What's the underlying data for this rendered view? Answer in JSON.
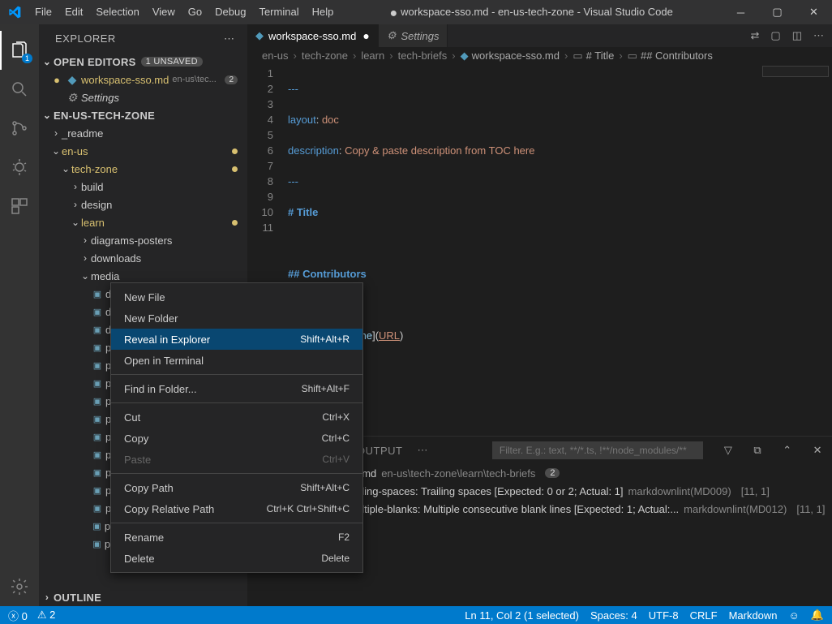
{
  "title": {
    "dot": "●",
    "text": "workspace-sso.md - en-us-tech-zone - Visual Studio Code"
  },
  "menu": {
    "file": "File",
    "edit": "Edit",
    "selection": "Selection",
    "view": "View",
    "go": "Go",
    "debug": "Debug",
    "terminal": "Terminal",
    "help": "Help"
  },
  "explorer": {
    "label": "EXPLORER"
  },
  "openEditors": {
    "label": "OPEN EDITORS",
    "unsaved": "1 UNSAVED"
  },
  "openFiles": {
    "f1": {
      "name": "workspace-sso.md",
      "path": "en-us\\tec...",
      "badge": "2"
    },
    "f2": {
      "name": "Settings"
    }
  },
  "workspace": {
    "label": "EN-US-TECH-ZONE"
  },
  "tree": {
    "readme": "_readme",
    "enus": "en-us",
    "techzone": "tech-zone",
    "build": "build",
    "design": "design",
    "learn": "learn",
    "diagrams": "diagrams-posters",
    "downloads": "downloads",
    "media": "media",
    "truncated": [
      "di",
      "di",
      "di",
      "po",
      "po",
      "po",
      "po",
      "po",
      "po",
      "po",
      "po",
      "po",
      "po"
    ],
    "poc1": "poc-guides_cvads-windows-vir...",
    "poc2": "poc-guides_cvads-windows-vir..."
  },
  "outline": {
    "label": "OUTLINE"
  },
  "tabs": {
    "t1": "workspace-sso.md",
    "t2": "Settings"
  },
  "breadcrumbs": {
    "p1": "en-us",
    "p2": "tech-zone",
    "p3": "learn",
    "p4": "tech-briefs",
    "p5": "workspace-sso.md",
    "p6": "# Title",
    "p7": "## Contributors"
  },
  "code": {
    "lines": [
      "1",
      "2",
      "3",
      "4",
      "5",
      "6",
      "7",
      "8",
      "9",
      "10",
      "11"
    ],
    "l1": "---",
    "l2a": "layout",
    "l2b": ": ",
    "l2c": "doc",
    "l3a": "description",
    "l3b": ": ",
    "l3c": "Copy & paste description from TOC here",
    "l4": "---",
    "l5": "# Title",
    "l7": "## Contributors",
    "l9a": "**Author:**",
    "l9b": " [",
    "l9c": "Name",
    "l9d": "](",
    "l9e": "URL",
    "l9f": ")"
  },
  "panel": {
    "tabs": {
      "problems": "PROBLEMS",
      "pcount": "2",
      "output": "OUTPUT"
    },
    "filter_placeholder": "Filter. E.g.: text, **/*.ts, !**/node_modules/**",
    "file": {
      "name": "workspace-sso.md",
      "path": "en-us\\tech-zone\\learn\\tech-briefs",
      "count": "2"
    },
    "p1": {
      "code": "MD009/no-trailing-spaces: Trailing spaces [Expected: 0 or 2; Actual: 1]",
      "src": "markdownlint(MD009)",
      "loc": "[11, 1]"
    },
    "p2": {
      "code": "MD012/no-multiple-blanks: Multiple consecutive blank lines [Expected: 1; Actual:...",
      "src": "markdownlint(MD012)",
      "loc": "[11, 1]"
    }
  },
  "status": {
    "errors": "0",
    "warnings": "2",
    "lncol": "Ln 11, Col 2 (1 selected)",
    "spaces": "Spaces: 4",
    "enc": "UTF-8",
    "eol": "CRLF",
    "lang": "Markdown"
  },
  "ctx": {
    "newfile": "New File",
    "newfolder": "New Folder",
    "reveal": "Reveal in Explorer",
    "reveal_kb": "Shift+Alt+R",
    "openterm": "Open in Terminal",
    "find": "Find in Folder...",
    "find_kb": "Shift+Alt+F",
    "cut": "Cut",
    "cut_kb": "Ctrl+X",
    "copy": "Copy",
    "copy_kb": "Ctrl+C",
    "paste": "Paste",
    "paste_kb": "Ctrl+V",
    "copypath": "Copy Path",
    "copypath_kb": "Shift+Alt+C",
    "copyrel": "Copy Relative Path",
    "copyrel_kb": "Ctrl+K Ctrl+Shift+C",
    "rename": "Rename",
    "rename_kb": "F2",
    "delete": "Delete",
    "delete_kb": "Delete"
  }
}
